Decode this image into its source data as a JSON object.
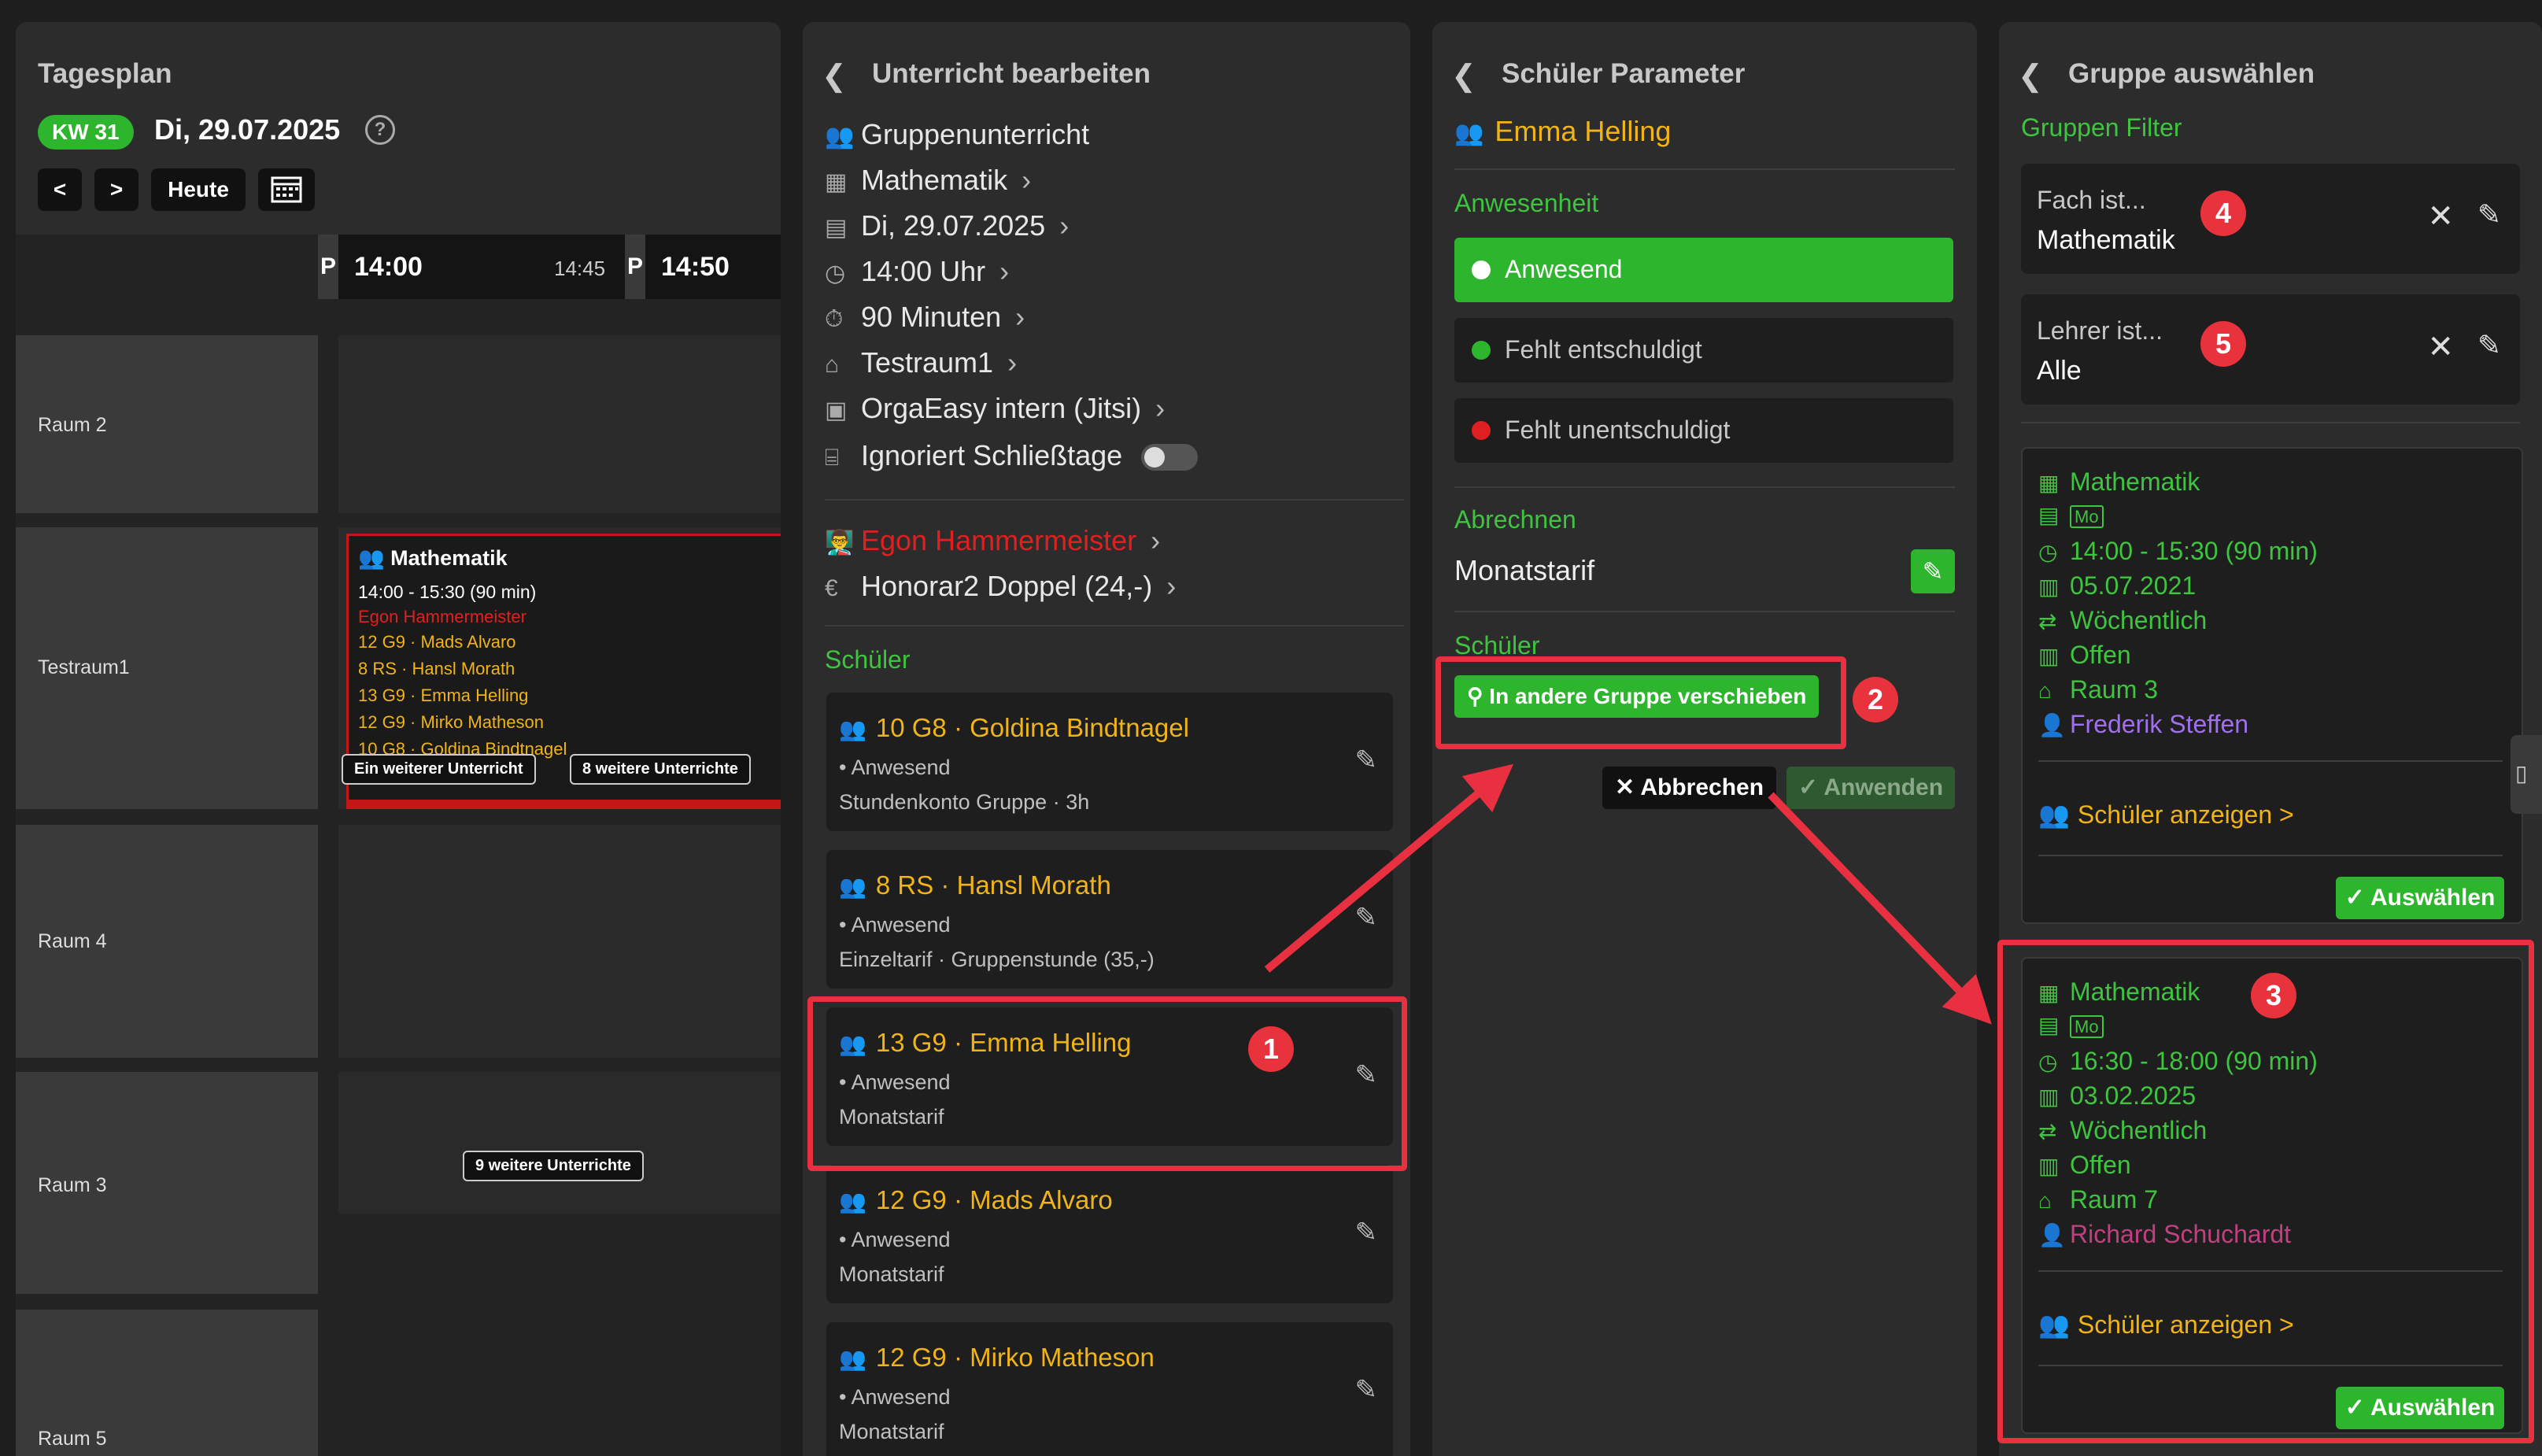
{
  "panel1": {
    "title": "Tagesplan",
    "kw": "KW 31",
    "date": "Di, 29.07.2025",
    "help": "?",
    "prev": "<",
    "next": ">",
    "today": "Heute",
    "time_p1": "P",
    "time1": "14:00",
    "time_mid": "14:45",
    "time_p2": "P",
    "time2": "14:50",
    "rooms": [
      "Raum 2",
      "Testraum1",
      "Raum 4",
      "Raum 3",
      "Raum 5"
    ],
    "lesson": {
      "title": "Mathematik",
      "time": "14:00 - 15:30  (90 min)",
      "teacher": "Egon Hammermeister",
      "students": [
        "12 G9 · Mads Alvaro",
        "8 RS · Hansl Morath",
        "13 G9 · Emma Helling",
        "12 G9 · Mirko Matheson",
        "10 G8 · Goldina Bindtnagel"
      ]
    },
    "tooltip_left": "Ein weiterer Unterricht",
    "tooltip_right": "8 weitere Unterrichte",
    "tooltip_raum3": "9 weitere Unterrichte"
  },
  "panel2": {
    "title": "Unterricht bearbeiten",
    "rows": [
      "Gruppenunterricht",
      "Mathematik",
      "Di, 29.07.2025",
      "14:00 Uhr",
      "90 Minuten",
      "Testraum1",
      "OrgaEasy intern (Jitsi)",
      "Ignoriert Schließtage"
    ],
    "teacher": "Egon Hammermeister",
    "honorar": "Honorar2 Doppel (24,-)",
    "students_label": "Schüler",
    "students": [
      {
        "name": "10 G8 · Goldina Bindtnagel",
        "status": "• Anwesend",
        "tarif": "Stundenkonto Gruppe · 3h"
      },
      {
        "name": "8 RS · Hansl Morath",
        "status": "• Anwesend",
        "tarif": "Einzeltarif · Gruppenstunde (35,-)"
      },
      {
        "name": "13 G9 · Emma Helling",
        "status": "• Anwesend",
        "tarif": "Monatstarif"
      },
      {
        "name": "12 G9 · Mads Alvaro",
        "status": "• Anwesend",
        "tarif": "Monatstarif"
      },
      {
        "name": "12 G9 · Mirko Matheson",
        "status": "• Anwesend",
        "tarif": "Monatstarif"
      }
    ]
  },
  "panel3": {
    "title": "Schüler Parameter",
    "student": "Emma Helling",
    "anwesenheit_label": "Anwesenheit",
    "options": [
      "Anwesend",
      "Fehlt entschuldigt",
      "Fehlt unentschuldigt"
    ],
    "abrechnen_label": "Abrechnen",
    "tarif": "Monatstarif",
    "schueler_label": "Schüler",
    "move_button": "In andere Gruppe verschieben",
    "cancel": "Abbrechen",
    "apply": "Anwenden"
  },
  "panel4": {
    "title": "Gruppe auswählen",
    "filter_label": "Gruppen Filter",
    "filters": [
      {
        "label": "Fach ist...",
        "value": "Mathematik"
      },
      {
        "label": "Lehrer ist...",
        "value": "Alle"
      }
    ],
    "groups": [
      {
        "subject": "Mathematik",
        "day": "Mo",
        "time": "14:00 - 15:30  (90 min)",
        "date": "05.07.2021",
        "repeat": "Wöchentlich",
        "state": "Offen",
        "room": "Raum 3",
        "teacher": "Frederik Steffen",
        "show": "Schüler anzeigen >",
        "select": "Auswählen"
      },
      {
        "subject": "Mathematik",
        "day": "Mo",
        "time": "16:30 - 18:00  (90 min)",
        "date": "03.02.2025",
        "repeat": "Wöchentlich",
        "state": "Offen",
        "room": "Raum 7",
        "teacher": "Richard Schuchardt",
        "show": "Schüler anzeigen >",
        "select": "Auswählen"
      }
    ]
  },
  "badges": [
    "1",
    "2",
    "3",
    "4",
    "5"
  ],
  "colors": {
    "accent_green": "#2db52d",
    "highlight_red": "#e83040",
    "student_yellow": "#f0b418",
    "teacher_purple": "#a070f0",
    "teacher_rose": "#c04080"
  }
}
